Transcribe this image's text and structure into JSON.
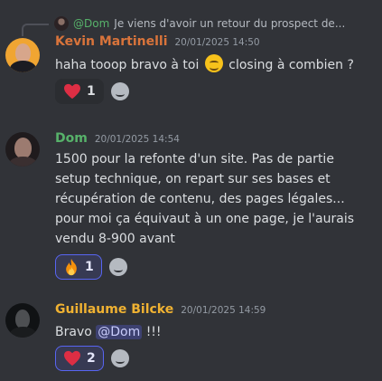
{
  "reply": {
    "author": "@Dom",
    "preview": "Je viens d'avoir un retour du prospect de..."
  },
  "messages": [
    {
      "author": "Kevin Martinelli",
      "timestamp": "20/01/2025 14:50",
      "text_before": "haha tooop bravo à toi",
      "emoji": "wink-emoji",
      "text_after": "closing à combien ?",
      "reaction": {
        "emoji": "heart-icon",
        "count": "1"
      }
    },
    {
      "author": "Dom",
      "timestamp": "20/01/2025 14:54",
      "lines": [
        "1500 pour la refonte d'un site. Pas de partie",
        "setup technique, on repart sur ses bases et",
        "récupération de contenu, des pages légales...",
        "pour moi ça équivaut à un one page, je l'aurais",
        "vendu 8-900 avant"
      ],
      "reaction": {
        "emoji": "fire-icon",
        "count": "1"
      }
    },
    {
      "author": "Guillaume Bilcke",
      "timestamp": "20/01/2025 14:59",
      "text_before": "Bravo",
      "mention": "@Dom",
      "text_after": "!!!",
      "reaction": {
        "emoji": "heart-icon",
        "count": "2"
      }
    }
  ],
  "colors": {
    "background": "#313338",
    "kevin_name": "#d9743b",
    "dom_name": "#57b26a",
    "guillaume_name": "#f0b232",
    "active_reaction_border": "#5865f2"
  }
}
